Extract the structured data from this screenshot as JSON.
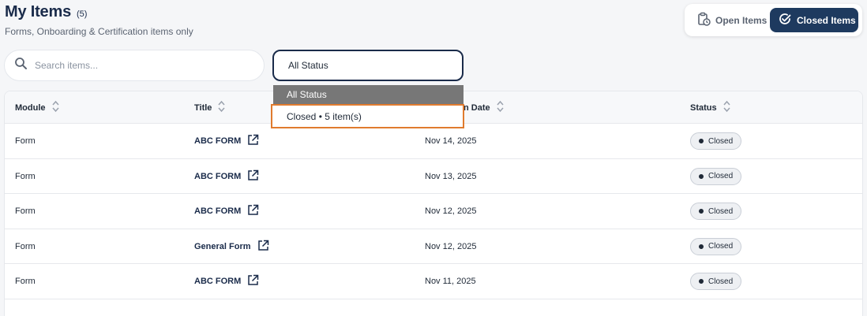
{
  "header": {
    "title": "My Items",
    "count": "(5)",
    "subtitle": "Forms, Onboarding & Certification items only"
  },
  "toggle": {
    "open_label": "Open Items",
    "closed_label": "Closed Items",
    "active": "closed",
    "open_icon": "clipboard-clock-icon",
    "closed_icon": "check-circle-icon"
  },
  "search": {
    "placeholder": "Search items...",
    "value": ""
  },
  "status_filter": {
    "value": "All Status",
    "options": [
      "All Status",
      "Closed • 5 item(s)"
    ],
    "highlighted": "All Status",
    "hovered": "Closed • 5 item(s)"
  },
  "table": {
    "columns": [
      "Module",
      "Title",
      "n Date",
      "Status"
    ],
    "rows": [
      {
        "module": "Form",
        "title": "ABC FORM",
        "date": "Nov 14, 2025",
        "status": "Closed"
      },
      {
        "module": "Form",
        "title": "ABC FORM",
        "date": "Nov 13, 2025",
        "status": "Closed"
      },
      {
        "module": "Form",
        "title": "ABC FORM",
        "date": "Nov 12, 2025",
        "status": "Closed"
      },
      {
        "module": "Form",
        "title": "General Form",
        "date": "Nov 12, 2025",
        "status": "Closed"
      },
      {
        "module": "Form",
        "title": "ABC FORM",
        "date": "Nov 11, 2025",
        "status": "Closed"
      }
    ]
  },
  "colors": {
    "navy": "#1a2b4a",
    "active_toggle": "#1e3a5f",
    "dropdown_highlight": "#777777",
    "focus_outline": "#e07b2e"
  }
}
